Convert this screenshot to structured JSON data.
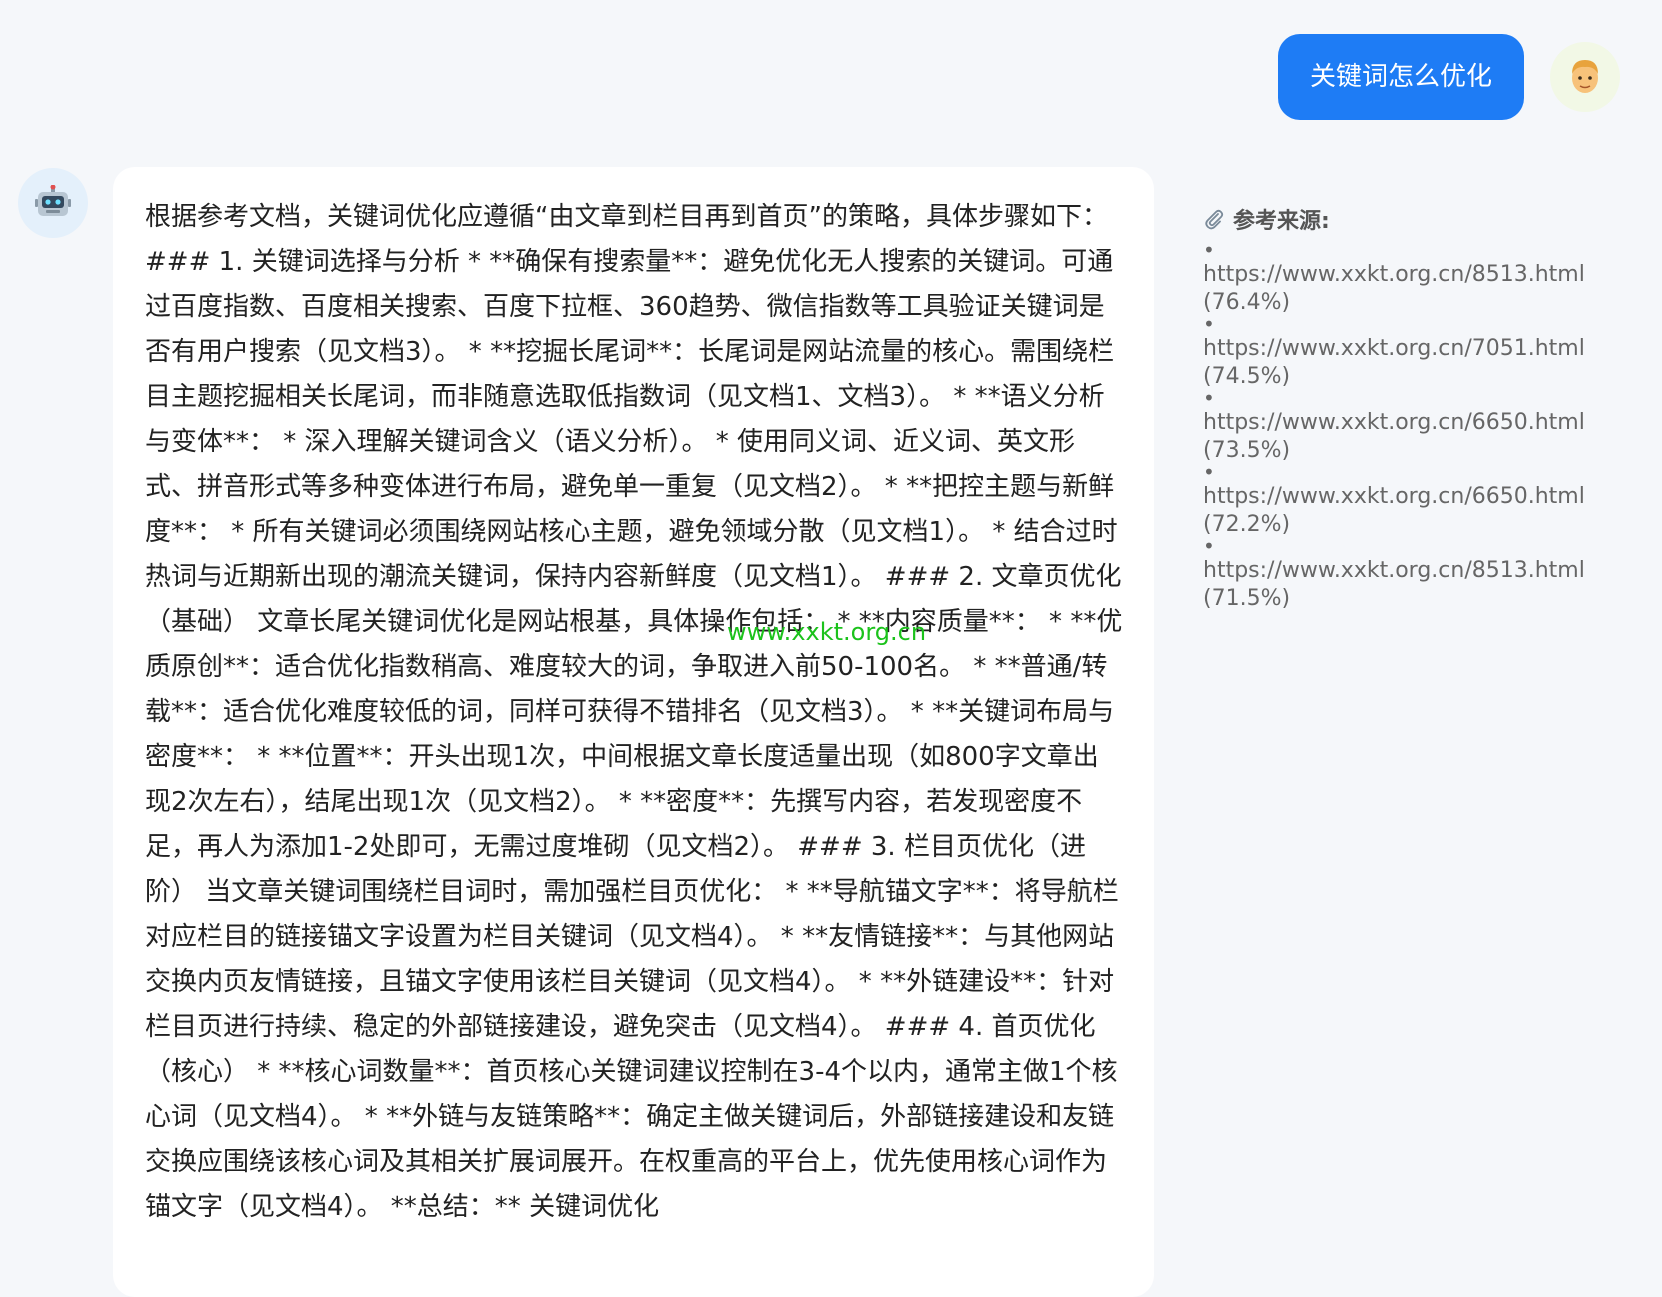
{
  "user_message": "关键词怎么优化",
  "assistant_message": "根据参考文档，关键词优化应遵循“由文章到栏目再到首页”的策略，具体步骤如下： ### 1. 关键词选择与分析 * **确保有搜索量**：避免优化无人搜索的关键词。可通过百度指数、百度相关搜索、百度下拉框、360趋势、微信指数等工具验证关键词是否有用户搜索（见文档3）。 * **挖掘长尾词**：长尾词是网站流量的核心。需围绕栏目主题挖掘相关长尾词，而非随意选取低指数词（见文档1、文档3）。 * **语义分析与变体**： * 深入理解关键词含义（语义分析）。 * 使用同义词、近义词、英文形式、拼音形式等多种变体进行布局，避免单一重复（见文档2）。 * **把控主题与新鲜度**： * 所有关键词必须围绕网站核心主题，避免领域分散（见文档1）。 * 结合过时热词与近期新出现的潮流关键词，保持内容新鲜度（见文档1）。 ### 2. 文章页优化（基础） 文章长尾关键词优化是网站根基，具体操作包括： * **内容质量**： * **优质原创**：适合优化指数稍高、难度较大的词，争取进入前50-100名。 * **普通/转载**：适合优化难度较低的词，同样可获得不错排名（见文档3）。 * **关键词布局与密度**： * **位置**：开头出现1次，中间根据文章长度适量出现（如800字文章出现2次左右），结尾出现1次（见文档2）。 * **密度**：先撰写内容，若发现密度不足，再人为添加1-2处即可，无需过度堆砌（见文档2）。 ### 3. 栏目页优化（进阶） 当文章关键词围绕栏目词时，需加强栏目页优化： * **导航锚文字**：将导航栏对应栏目的链接锚文字设置为栏目关键词（见文档4）。 * **友情链接**：与其他网站交换内页友情链接，且锚文字使用该栏目关键词（见文档4）。 * **外链建设**：针对栏目页进行持续、稳定的外部链接建设，避免突击（见文档4）。 ### 4. 首页优化（核心） * **核心词数量**：首页核心关键词建议控制在3-4个以内，通常主做1个核心词（见文档4）。 * **外链与友链策略**：确定主做关键词后，外部链接建设和友链交换应围绕该核心词及其相关扩展词展开。在权重高的平台上，优先使用核心词作为锚文字（见文档4）。 **总结：** 关键词优化",
  "watermark": "www.xxkt.org.cn",
  "sources": {
    "title": "参考来源:",
    "bullet": "•",
    "items": [
      {
        "url": "https://www.xxkt.org.cn/8513.html",
        "score": "(76.4%)"
      },
      {
        "url": "https://www.xxkt.org.cn/7051.html",
        "score": "(74.5%)"
      },
      {
        "url": "https://www.xxkt.org.cn/6650.html",
        "score": "(73.5%)"
      },
      {
        "url": "https://www.xxkt.org.cn/6650.html",
        "score": "(72.2%)"
      },
      {
        "url": "https://www.xxkt.org.cn/8513.html",
        "score": "(71.5%)"
      }
    ]
  },
  "icons": {
    "user_avatar": "person-face-icon",
    "bot_avatar": "robot-icon",
    "sources": "paperclip-icon"
  },
  "colors": {
    "user_bubble": "#1e7cf5",
    "background": "#f5f7fa",
    "watermark": "#1bc21b"
  }
}
